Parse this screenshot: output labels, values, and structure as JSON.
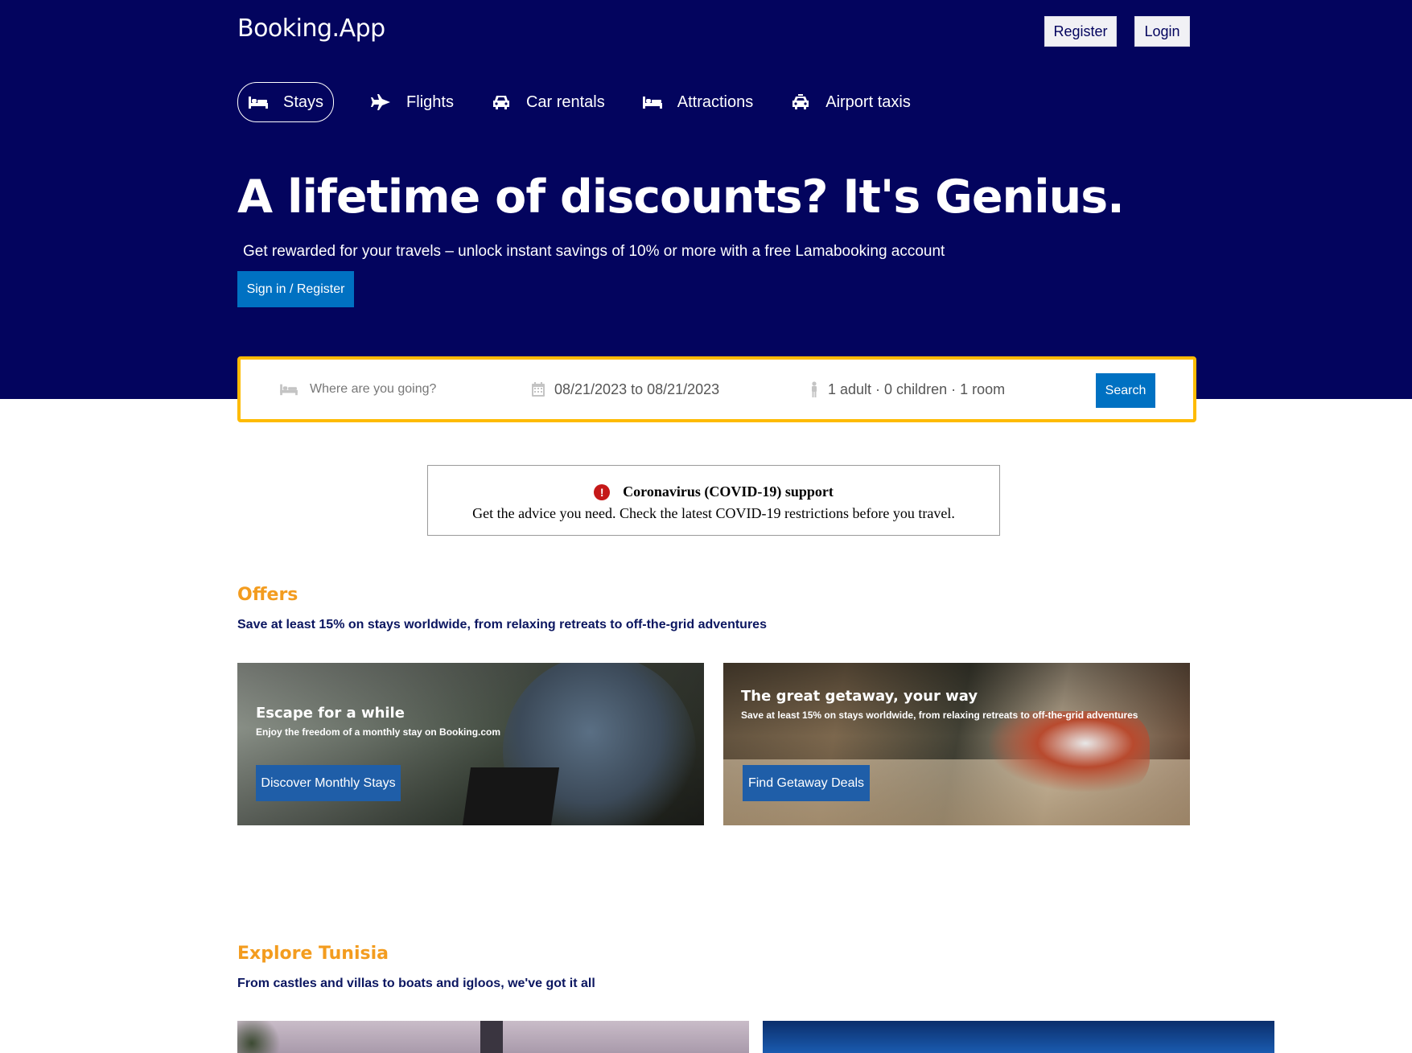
{
  "header": {
    "logo": "Booking.App",
    "register_label": "Register",
    "login_label": "Login"
  },
  "nav": [
    {
      "label": "Stays",
      "icon": "bed-icon",
      "active": true
    },
    {
      "label": "Flights",
      "icon": "plane-icon",
      "active": false
    },
    {
      "label": "Car rentals",
      "icon": "car-icon",
      "active": false
    },
    {
      "label": "Attractions",
      "icon": "bed-icon",
      "active": false
    },
    {
      "label": "Airport taxis",
      "icon": "taxi-icon",
      "active": false
    }
  ],
  "hero": {
    "title": "A lifetime of discounts? It's Genius.",
    "subtitle": "Get rewarded for your travels – unlock instant savings of 10% or more with a free Lamabooking account",
    "button_label": "Sign in / Register"
  },
  "search": {
    "destination_placeholder": "Where are you going?",
    "dates": "08/21/2023 to 08/21/2023",
    "guests": "1 adult · 0 children · 1 room",
    "button_label": "Search"
  },
  "covid": {
    "title": "Coronavirus (COVID-19) support",
    "text": "Get the advice you need. Check the latest COVID-19 restrictions before you travel."
  },
  "offers": {
    "title": "Offers",
    "subtitle": "Save at least 15% on stays worldwide, from relaxing retreats to off-the-grid adventures",
    "cards": [
      {
        "title": "Escape for a while",
        "subtitle": "Enjoy the freedom of a monthly stay on Booking.com",
        "button": "Discover Monthly Stays"
      },
      {
        "title": "The great getaway, your way",
        "subtitle": "Save at least 15% on stays worldwide, from relaxing retreats to off-the-grid adventures",
        "button": "Find Getaway Deals"
      }
    ]
  },
  "explore": {
    "title": "Explore Tunisia",
    "subtitle": "From castles and villas to boats and igloos, we've got it all"
  },
  "colors": {
    "header_bg": "#03045e",
    "primary_blue": "#0071c2",
    "accent_orange": "#f39c1f",
    "search_border": "#febb02"
  }
}
